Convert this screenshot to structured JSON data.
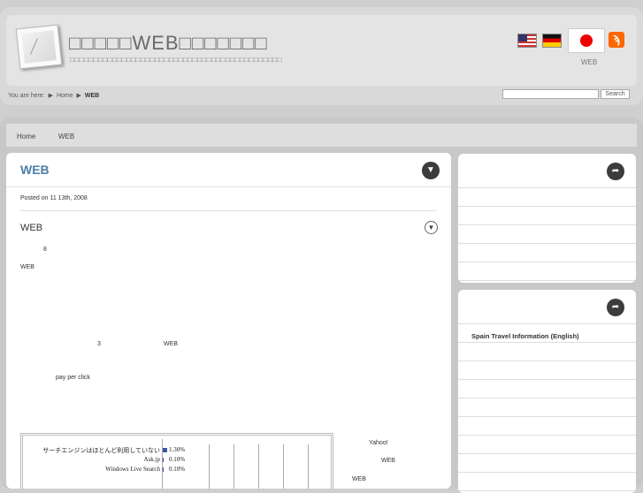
{
  "header": {
    "site_title": "□□□□□WEB□□□□□□□",
    "site_description": "□□□□□□□□□□□□□□□□□□□□□□□□□□□□□□□□□□□□□□□□□□□□□",
    "language_label": "WEB",
    "flags": [
      "flag-us",
      "flag-de",
      "flag-jp"
    ],
    "rss_icon": "rss-icon",
    "breadcrumb": {
      "prefix": "You are here:",
      "home": "Home",
      "current": "WEB"
    },
    "search": {
      "placeholder": "",
      "button_label": "Search"
    }
  },
  "nav": {
    "items": [
      "Home",
      "WEB"
    ]
  },
  "post": {
    "title": "WEB",
    "title_icon": "chevron-down-circle-icon",
    "posted": "Posted on 11   13th, 2008",
    "heading": "WEB",
    "toggle_icon": "chevron-down-outline-icon",
    "paragraphs": [
      "8",
      "WEB",
      "3",
      "WEB",
      "pay per click",
      "Yahoo!",
      "WEB",
      "WEB"
    ]
  },
  "chart_data": {
    "type": "bar",
    "categories": [
      "サーチエンジンはほとんど利用していない",
      "Ask.jp",
      "Windows Live Search"
    ],
    "values": [
      1.3,
      0.1,
      0.1
    ],
    "value_labels": [
      "1.30%",
      "0.10%",
      "0.10%"
    ],
    "xlabel": "",
    "ylabel": "",
    "colors": {
      "bar": "#3a56a8"
    }
  },
  "sidebar": {
    "box1": {
      "icon": "share-arrow-icon",
      "rows": [
        "",
        "",
        "",
        "",
        ""
      ]
    },
    "box2": {
      "icon": "share-arrow-icon",
      "rows": [
        "Spain Travel Information (English)",
        "",
        "",
        "",
        "",
        "",
        "",
        "",
        ""
      ]
    }
  }
}
